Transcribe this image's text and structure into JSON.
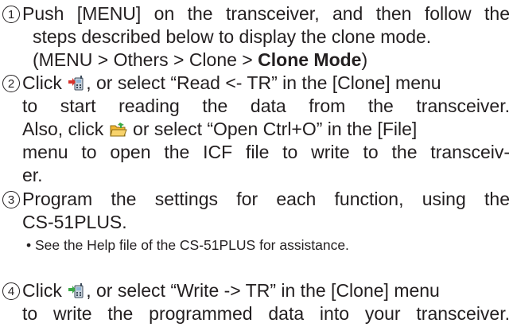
{
  "steps": [
    {
      "number": "1",
      "lines": [
        "Push [MENU] on the transceiver, and then follow the",
        "steps described below to display the clone mode.",
        "(MENU > Others > Clone > "
      ],
      "bold_tail": "Clone Mode",
      "tail_end": ")"
    },
    {
      "number": "2",
      "line1_pre": "Click ",
      "line1_post": ", or select “Read <- TR” in the [Clone] menu",
      "line2": "to start reading the data from the transceiver.",
      "line3_pre": "Also, click ",
      "line3_post": " or select “Open Ctrl+O” in the [File]",
      "line4": "menu to open the ICF file to write to the transceiv-",
      "line5": "er.",
      "icon_read": "read-from-transceiver-icon",
      "icon_open": "open-folder-icon"
    },
    {
      "number": "3",
      "line1": "Program the settings for each function, using the",
      "line2": "CS-51PLUS.",
      "note": "• See the Help file of the CS-51PLUS for assistance."
    },
    {
      "number": "4",
      "line1_pre": "Click ",
      "line1_post": ", or select “Write -> TR” in the [Clone] menu",
      "line2": "to write the programmed data into your transceiver.",
      "icon_write": "write-to-transceiver-icon"
    }
  ],
  "colors": {
    "text": "#231f20",
    "icon_green": "#3aa845",
    "icon_red": "#d6322b",
    "icon_folder": "#f2b632"
  }
}
